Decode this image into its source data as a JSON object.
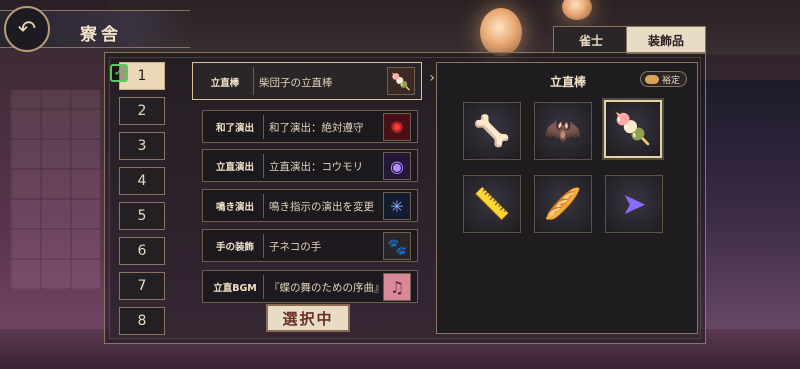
{
  "header": {
    "title": "寮舎"
  },
  "tabs": [
    {
      "label": "雀士",
      "active": false
    },
    {
      "label": "装飾品",
      "active": true
    }
  ],
  "slots": [
    "1",
    "2",
    "3",
    "4",
    "5",
    "6",
    "7",
    "8"
  ],
  "active_slot": "1",
  "decorations": [
    {
      "category": "立直棒",
      "name": "柴団子の立直棒",
      "icon": "dango-icon",
      "selected": true
    },
    {
      "category": "和了演出",
      "name": "和了演出：絶対遵守",
      "icon": "red-burst-icon"
    },
    {
      "category": "立直演出",
      "name": "立直演出：コウモリ",
      "icon": "bat-icon"
    },
    {
      "category": "鳴き演出",
      "name": "鳴き指示の演出を変更",
      "icon": "sparkle-icon"
    },
    {
      "category": "手の装飾",
      "name": "子ネコの手",
      "icon": "cat-paw-icon"
    },
    {
      "category": "立直BGM",
      "name": "『蝶の舞のための序曲』",
      "icon": "music-icon"
    }
  ],
  "selected_stamp": "選択中",
  "panel": {
    "title": "立直棒",
    "fix_label": "裕定",
    "items": [
      {
        "icon": "bone-icon",
        "glyph": "🦴",
        "selected": false
      },
      {
        "icon": "bat-stick-icon",
        "glyph": "🦇",
        "selected": false
      },
      {
        "icon": "dango-icon",
        "glyph": "🍡",
        "selected": true
      },
      {
        "icon": "ruler-icon",
        "glyph": "📏",
        "selected": false
      },
      {
        "icon": "baguette-icon",
        "glyph": "🥖",
        "selected": false
      },
      {
        "icon": "neon-arrow-icon",
        "glyph": "➤",
        "selected": false
      }
    ]
  },
  "colors": {
    "accent": "#d9c29a",
    "active_bg": "#e9dcc4",
    "check": "#5acb5a"
  }
}
